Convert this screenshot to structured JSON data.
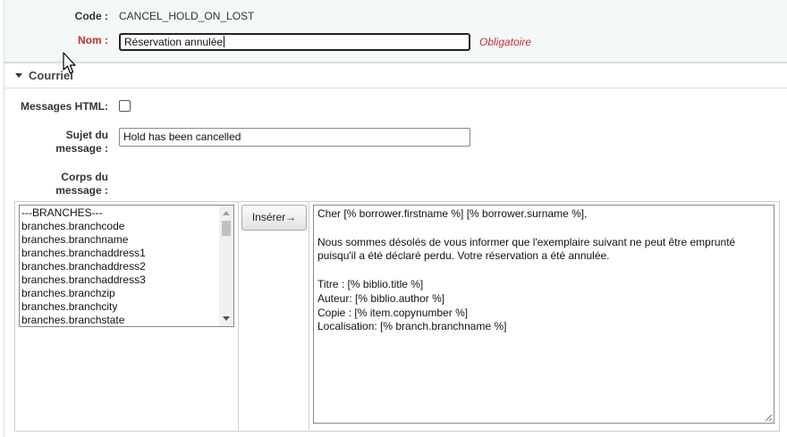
{
  "header": {
    "code_label": "Code :",
    "code_value": "CANCEL_HOLD_ON_LOST",
    "nom_label": "Nom :",
    "nom_value": "Réservation annulée",
    "required_text": "Obligatoire"
  },
  "section": {
    "title": "Courriel",
    "html_label": "Messages HTML:",
    "html_checked": false,
    "sujet_label_1": "Sujet du",
    "sujet_label_2": "message :",
    "sujet_value": "Hold has been cancelled",
    "corps_label_1": "Corps du",
    "corps_label_2": "message :"
  },
  "fields_list": [
    "---BRANCHES---",
    "branches.branchcode",
    "branches.branchname",
    "branches.branchaddress1",
    "branches.branchaddress2",
    "branches.branchaddress3",
    "branches.branchzip",
    "branches.branchcity",
    "branches.branchstate"
  ],
  "insert_button": "Insérer→",
  "body_lines": [
    "Cher [% borrower.firstname %] [% borrower.surname %],",
    "",
    "Nous sommes désolés de vous informer que l'exemplaire suivant ne peut être emprunté",
    "puisqu'il a été déclaré perdu. Votre réservation a été annulée.",
    "",
    "Titre : [% biblio.title %]",
    "Auteur: [% biblio.author %]",
    "Copie : [% item.copynumber %]",
    "Localisation: [% branch.branchname %]"
  ],
  "icons": {
    "collapse": "triangle-down-icon",
    "cursor": "mouse-pointer-icon",
    "resize": "resize-grip-icon"
  },
  "colors": {
    "required": "#c42f2f",
    "panel_bg": "#f4f8f9"
  }
}
